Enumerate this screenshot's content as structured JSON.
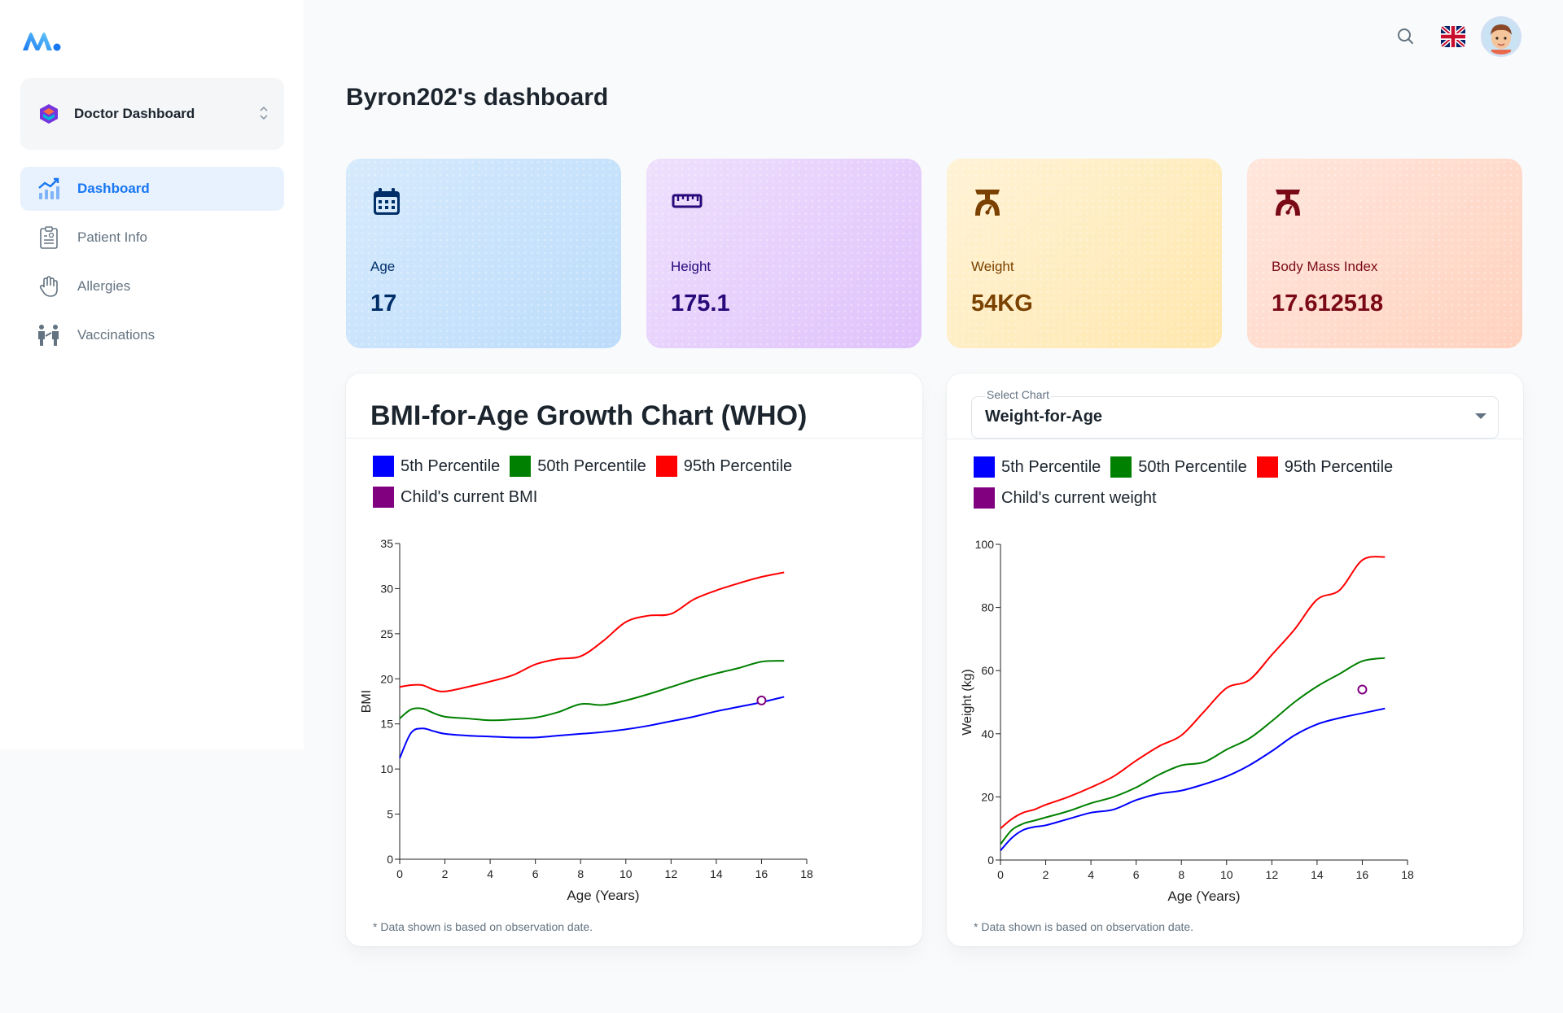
{
  "app": {
    "workspace_label": "Doctor Dashboard",
    "page_title": "Byron202's dashboard"
  },
  "sidebar": {
    "items": [
      {
        "label": "Dashboard",
        "icon": "chart-up-icon",
        "active": true
      },
      {
        "label": "Patient Info",
        "icon": "clipboard-icon",
        "active": false
      },
      {
        "label": "Allergies",
        "icon": "hand-icon",
        "active": false
      },
      {
        "label": "Vaccinations",
        "icon": "vaccination-icon",
        "active": false
      }
    ]
  },
  "header": {
    "icons": [
      "search-icon",
      "uk-flag-icon",
      "avatar"
    ]
  },
  "stats": {
    "age": {
      "label": "Age",
      "value": "17",
      "icon": "calendar-icon"
    },
    "height": {
      "label": "Height",
      "value": "175.1",
      "icon": "ruler-icon"
    },
    "weight": {
      "label": "Weight",
      "value": "54KG",
      "icon": "scale-icon"
    },
    "bmi": {
      "label": "Body Mass Index",
      "value": "17.612518",
      "icon": "scale-icon"
    }
  },
  "colors": {
    "accent": "#1877f2",
    "p5": "#0000ff",
    "p50": "#008000",
    "p95": "#ff0000",
    "child": "#800080"
  },
  "left_panel": {
    "title": "BMI-for-Age Growth Chart (WHO)",
    "legend": [
      "5th Percentile",
      "50th Percentile",
      "95th Percentile",
      "Child's current BMI"
    ],
    "footnote": "* Data shown is based on observation date."
  },
  "right_panel": {
    "select_label": "Select Chart",
    "select_value": "Weight-for-Age",
    "legend": [
      "5th Percentile",
      "50th Percentile",
      "95th Percentile",
      "Child's current weight"
    ],
    "footnote": "* Data shown is based on observation date."
  },
  "chart_data": [
    {
      "type": "line",
      "xlabel": "Age (Years)",
      "ylabel": "BMI",
      "xlim": [
        0,
        18
      ],
      "ylim": [
        0,
        35
      ],
      "xticks": [
        0,
        2,
        4,
        6,
        8,
        10,
        12,
        14,
        16,
        18
      ],
      "yticks": [
        0,
        5,
        10,
        15,
        20,
        25,
        30,
        35
      ],
      "x": [
        0,
        0.5,
        1,
        1.5,
        2,
        3,
        4,
        5,
        6,
        7,
        8,
        9,
        10,
        11,
        12,
        13,
        14,
        15,
        16,
        17
      ],
      "series": [
        {
          "name": "5th Percentile",
          "values": [
            11.2,
            14.0,
            14.5,
            14.2,
            13.9,
            13.7,
            13.6,
            13.5,
            13.5,
            13.7,
            13.9,
            14.1,
            14.4,
            14.8,
            15.3,
            15.8,
            16.4,
            16.9,
            17.4,
            18.0
          ]
        },
        {
          "name": "50th Percentile",
          "values": [
            15.6,
            16.6,
            16.7,
            16.2,
            15.8,
            15.6,
            15.4,
            15.5,
            15.7,
            16.3,
            17.2,
            17.1,
            17.6,
            18.3,
            19.1,
            19.9,
            20.6,
            21.2,
            21.9,
            22.0
          ]
        },
        {
          "name": "95th Percentile",
          "values": [
            19.1,
            19.3,
            19.3,
            18.8,
            18.6,
            19.1,
            19.7,
            20.4,
            21.6,
            22.2,
            22.5,
            24.2,
            26.3,
            27.0,
            27.2,
            28.8,
            29.8,
            30.6,
            31.3,
            31.8
          ]
        }
      ],
      "child_point": {
        "name": "Child's current BMI",
        "x": 16,
        "y": 17.6
      }
    },
    {
      "type": "line",
      "xlabel": "Age (Years)",
      "ylabel": "Weight (kg)",
      "xlim": [
        0,
        18
      ],
      "ylim": [
        0,
        100
      ],
      "xticks": [
        0,
        2,
        4,
        6,
        8,
        10,
        12,
        14,
        16,
        18
      ],
      "yticks": [
        0,
        20,
        40,
        60,
        80,
        100
      ],
      "x": [
        0,
        0.5,
        1,
        1.5,
        2,
        3,
        4,
        5,
        6,
        7,
        8,
        9,
        10,
        11,
        12,
        13,
        14,
        15,
        16,
        17
      ],
      "series": [
        {
          "name": "5th Percentile",
          "values": [
            3.0,
            7.0,
            9.5,
            10.5,
            11.0,
            13.0,
            15.0,
            16.0,
            19.0,
            21.0,
            22.0,
            24.0,
            26.5,
            30.0,
            34.5,
            39.5,
            43.0,
            45.0,
            46.5,
            48.0
          ]
        },
        {
          "name": "50th Percentile",
          "values": [
            5.0,
            9.5,
            11.5,
            12.5,
            13.5,
            15.5,
            18.0,
            20.0,
            23.0,
            27.0,
            30.0,
            31.0,
            35.0,
            38.5,
            44.0,
            50.0,
            55.0,
            59.0,
            63.0,
            64.0
          ]
        },
        {
          "name": "95th Percentile",
          "values": [
            10.0,
            13.0,
            15.0,
            16.0,
            17.5,
            20.0,
            23.0,
            26.5,
            31.5,
            36.0,
            39.5,
            47.0,
            54.5,
            57.0,
            65.0,
            73.0,
            82.5,
            85.5,
            95.0,
            96.0
          ]
        }
      ],
      "child_point": {
        "name": "Child's current weight",
        "x": 16,
        "y": 54
      }
    }
  ]
}
